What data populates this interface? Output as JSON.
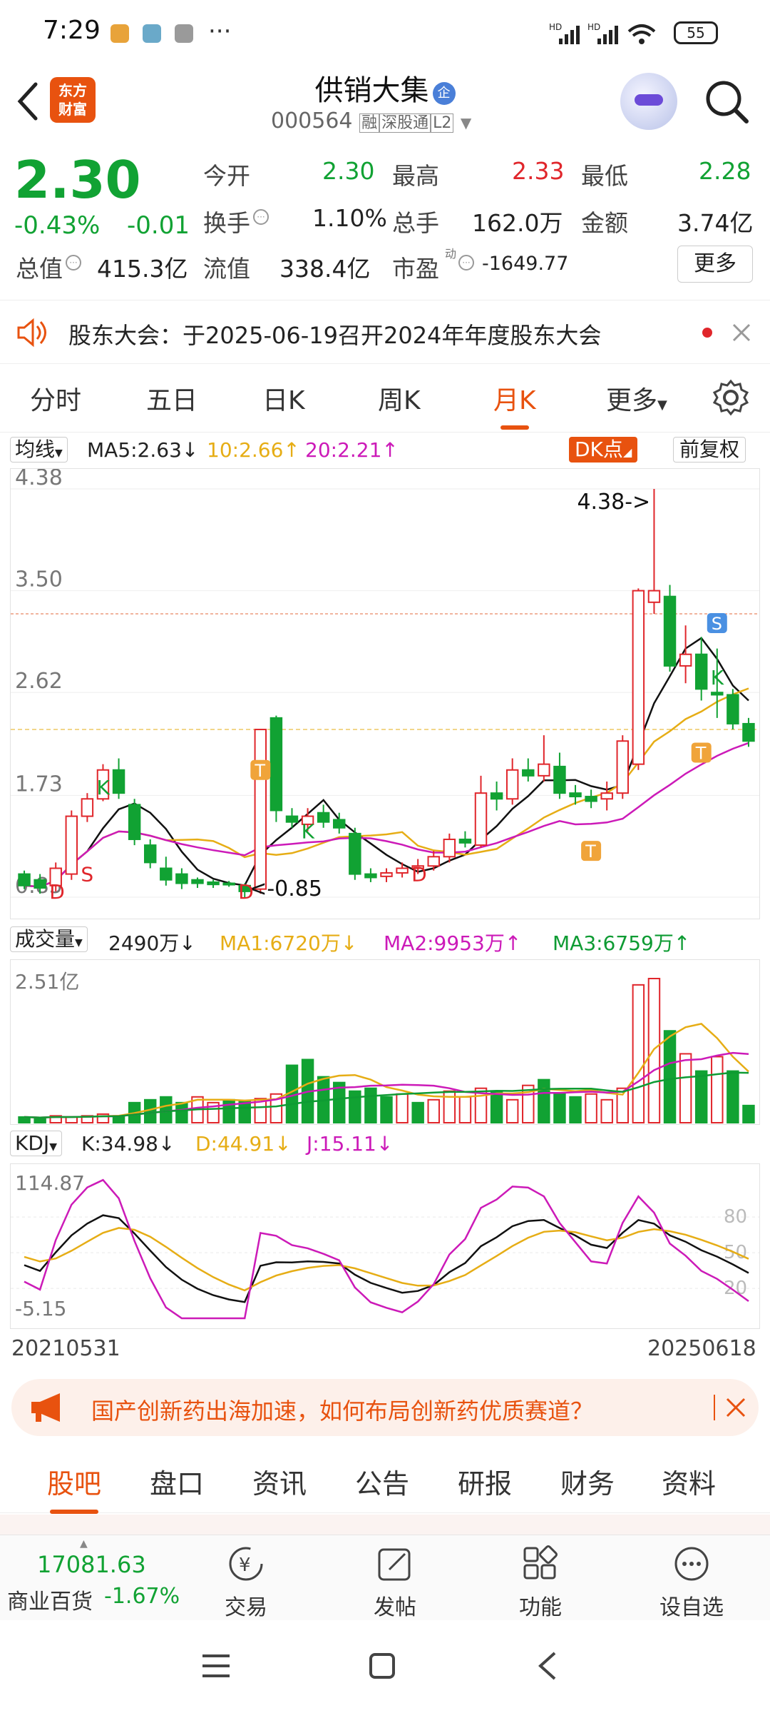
{
  "status": {
    "time": "7:29",
    "battery": "55",
    "more": "···"
  },
  "header": {
    "title": "供销大集",
    "code": "000564",
    "badges": [
      "融",
      "深股通",
      "L2"
    ]
  },
  "quote": {
    "price": "2.30",
    "change_pct": "-0.43%",
    "change": "-0.01",
    "open_label": "今开",
    "open": "2.30",
    "high_label": "最高",
    "high": "2.33",
    "low_label": "最低",
    "low": "2.28",
    "turnover_label": "换手",
    "turnover": "1.10%",
    "volume_label": "总手",
    "volume": "162.0万",
    "amount_label": "金额",
    "amount": "3.74亿",
    "mktcap_label": "总值",
    "mktcap": "415.3亿",
    "float_label": "流值",
    "float_cap": "338.4亿",
    "pe_label": "市盈",
    "pe_sup": "动",
    "pe": "-1649.77",
    "more_button": "更多"
  },
  "notice": {
    "text": "股东大会：于2025-06-19召开2024年年度股东大会"
  },
  "tabs": [
    "分时",
    "五日",
    "日K",
    "周K",
    "月K",
    "更多"
  ],
  "active_tab": 4,
  "ma_bar": {
    "selector": "均线",
    "ma5": "MA5:2.63",
    "ma10": "10:2.66",
    "ma20": "20:2.21",
    "dk": "DK点",
    "adjust": "前复权"
  },
  "volume_bar": {
    "selector": "成交量",
    "vol": "2490万",
    "ma1": "MA1:6720万",
    "ma2": "MA2:9953万",
    "ma3": "MA3:6759万"
  },
  "kdj_bar": {
    "selector": "KDJ",
    "k": "K:34.98",
    "d": "D:44.91",
    "j": "J:15.11"
  },
  "chart_data": [
    {
      "type": "candlestick",
      "title": "",
      "y_ticks": [
        "4.38",
        "3.50",
        "2.62",
        "1.73",
        "0.85"
      ],
      "ylim": [
        0.85,
        4.38
      ],
      "max_marker": "4.38->",
      "min_marker": "<-0.85",
      "signals": [
        "S",
        "D",
        "K",
        "D",
        "T",
        "K",
        "D",
        "T",
        "T",
        "S",
        "K"
      ],
      "candles": [
        {
          "o": 1.05,
          "c": 0.95,
          "h": 1.08,
          "l": 0.92
        },
        {
          "o": 1.0,
          "c": 0.93,
          "h": 1.05,
          "l": 0.88
        },
        {
          "o": 0.95,
          "c": 1.1,
          "h": 1.15,
          "l": 0.9
        },
        {
          "o": 1.05,
          "c": 1.55,
          "h": 1.6,
          "l": 1.0
        },
        {
          "o": 1.55,
          "c": 1.7,
          "h": 1.75,
          "l": 1.5
        },
        {
          "o": 1.7,
          "c": 1.95,
          "h": 2.0,
          "l": 1.68
        },
        {
          "o": 1.95,
          "c": 1.75,
          "h": 2.05,
          "l": 1.7
        },
        {
          "o": 1.65,
          "c": 1.35,
          "h": 1.7,
          "l": 1.3
        },
        {
          "o": 1.3,
          "c": 1.15,
          "h": 1.35,
          "l": 1.1
        },
        {
          "o": 1.1,
          "c": 1.0,
          "h": 1.2,
          "l": 0.95
        },
        {
          "o": 1.05,
          "c": 0.97,
          "h": 1.1,
          "l": 0.92
        },
        {
          "o": 1.0,
          "c": 0.97,
          "h": 1.02,
          "l": 0.93
        },
        {
          "o": 0.98,
          "c": 0.96,
          "h": 1.0,
          "l": 0.93
        },
        {
          "o": 0.97,
          "c": 0.96,
          "h": 0.99,
          "l": 0.94
        },
        {
          "o": 0.95,
          "c": 0.9,
          "h": 0.97,
          "l": 0.85
        },
        {
          "o": 0.92,
          "c": 2.3,
          "h": 2.3,
          "l": 0.88
        },
        {
          "o": 2.4,
          "c": 1.6,
          "h": 2.42,
          "l": 1.5
        },
        {
          "o": 1.55,
          "c": 1.5,
          "h": 1.62,
          "l": 1.45
        },
        {
          "o": 1.48,
          "c": 1.55,
          "h": 1.62,
          "l": 1.42
        },
        {
          "o": 1.58,
          "c": 1.5,
          "h": 1.65,
          "l": 1.45
        },
        {
          "o": 1.52,
          "c": 1.45,
          "h": 1.58,
          "l": 1.4
        },
        {
          "o": 1.4,
          "c": 1.05,
          "h": 1.45,
          "l": 1.0
        },
        {
          "o": 1.05,
          "c": 1.02,
          "h": 1.1,
          "l": 0.98
        },
        {
          "o": 1.03,
          "c": 1.06,
          "h": 1.1,
          "l": 0.98
        },
        {
          "o": 1.06,
          "c": 1.1,
          "h": 1.15,
          "l": 1.02
        },
        {
          "o": 1.1,
          "c": 1.12,
          "h": 1.18,
          "l": 1.05
        },
        {
          "o": 1.12,
          "c": 1.2,
          "h": 1.25,
          "l": 1.08
        },
        {
          "o": 1.2,
          "c": 1.35,
          "h": 1.4,
          "l": 1.15
        },
        {
          "o": 1.35,
          "c": 1.32,
          "h": 1.42,
          "l": 1.28
        },
        {
          "o": 1.3,
          "c": 1.75,
          "h": 1.9,
          "l": 1.28
        },
        {
          "o": 1.75,
          "c": 1.7,
          "h": 1.85,
          "l": 1.6
        },
        {
          "o": 1.7,
          "c": 1.95,
          "h": 2.05,
          "l": 1.65
        },
        {
          "o": 1.95,
          "c": 1.9,
          "h": 2.05,
          "l": 1.85
        },
        {
          "o": 1.9,
          "c": 2.0,
          "h": 2.25,
          "l": 1.85
        },
        {
          "o": 1.98,
          "c": 1.75,
          "h": 2.1,
          "l": 1.7
        },
        {
          "o": 1.75,
          "c": 1.72,
          "h": 1.82,
          "l": 1.65
        },
        {
          "o": 1.72,
          "c": 1.68,
          "h": 1.78,
          "l": 1.62
        },
        {
          "o": 1.7,
          "c": 1.75,
          "h": 1.85,
          "l": 1.6
        },
        {
          "o": 1.75,
          "c": 2.2,
          "h": 2.25,
          "l": 1.7
        },
        {
          "o": 2.0,
          "c": 3.5,
          "h": 3.52,
          "l": 1.95
        },
        {
          "o": 3.4,
          "c": 3.5,
          "h": 4.38,
          "l": 3.3
        },
        {
          "o": 3.45,
          "c": 2.85,
          "h": 3.55,
          "l": 2.8
        },
        {
          "o": 2.85,
          "c": 2.95,
          "h": 3.2,
          "l": 2.7
        },
        {
          "o": 2.95,
          "c": 2.65,
          "h": 3.1,
          "l": 2.55
        },
        {
          "o": 2.62,
          "c": 2.6,
          "h": 3.0,
          "l": 2.4
        },
        {
          "o": 2.6,
          "c": 2.35,
          "h": 2.65,
          "l": 2.3
        },
        {
          "o": 2.35,
          "c": 2.2,
          "h": 2.4,
          "l": 2.15
        }
      ]
    },
    {
      "type": "bar",
      "title": "成交量",
      "y_ticks": [
        "2.51亿"
      ],
      "ylim": [
        0,
        2.51
      ],
      "unit": "亿",
      "values": [
        0.1,
        0.08,
        0.12,
        0.1,
        0.12,
        0.15,
        0.12,
        0.35,
        0.4,
        0.45,
        0.35,
        0.45,
        0.35,
        0.4,
        0.38,
        0.42,
        0.5,
        1.0,
        1.1,
        0.8,
        0.7,
        0.55,
        0.6,
        0.45,
        0.5,
        0.35,
        0.4,
        0.55,
        0.45,
        0.6,
        0.55,
        0.4,
        0.65,
        0.75,
        0.5,
        0.45,
        0.5,
        0.4,
        0.6,
        2.4,
        2.51,
        1.6,
        1.2,
        0.9,
        1.15,
        0.9,
        0.3
      ],
      "up": [
        false,
        false,
        true,
        true,
        true,
        true,
        false,
        false,
        false,
        false,
        false,
        true,
        true,
        false,
        false,
        true,
        true,
        false,
        false,
        false,
        false,
        false,
        false,
        false,
        true,
        false,
        true,
        true,
        true,
        true,
        false,
        true,
        true,
        false,
        false,
        false,
        true,
        true,
        true,
        true,
        true,
        false,
        true,
        false,
        true,
        false,
        false
      ]
    },
    {
      "type": "line",
      "title": "KDJ",
      "y_ticks": [
        "114.87",
        "-5.15"
      ],
      "right_ticks": [
        "80",
        "50",
        "20"
      ],
      "ylim": [
        -5.15,
        114.87
      ]
    }
  ],
  "dates": {
    "start": "20210531",
    "end": "20250618"
  },
  "ad": {
    "text": "国产创新药出海加速，如何布局创新药优质赛道？"
  },
  "bottom_tabs": [
    "股吧",
    "盘口",
    "资讯",
    "公告",
    "研报",
    "财务",
    "资料"
  ],
  "dock": {
    "index_value": "17081.63",
    "index_name": "商业百货",
    "index_change": "-1.67%",
    "items": [
      "交易",
      "发帖",
      "功能",
      "设自选"
    ]
  },
  "colors": {
    "up": "#e0262b",
    "down": "#11a233",
    "accent": "#e8520f",
    "ma10": "#e6ad15",
    "ma20": "#cc1ab8"
  }
}
